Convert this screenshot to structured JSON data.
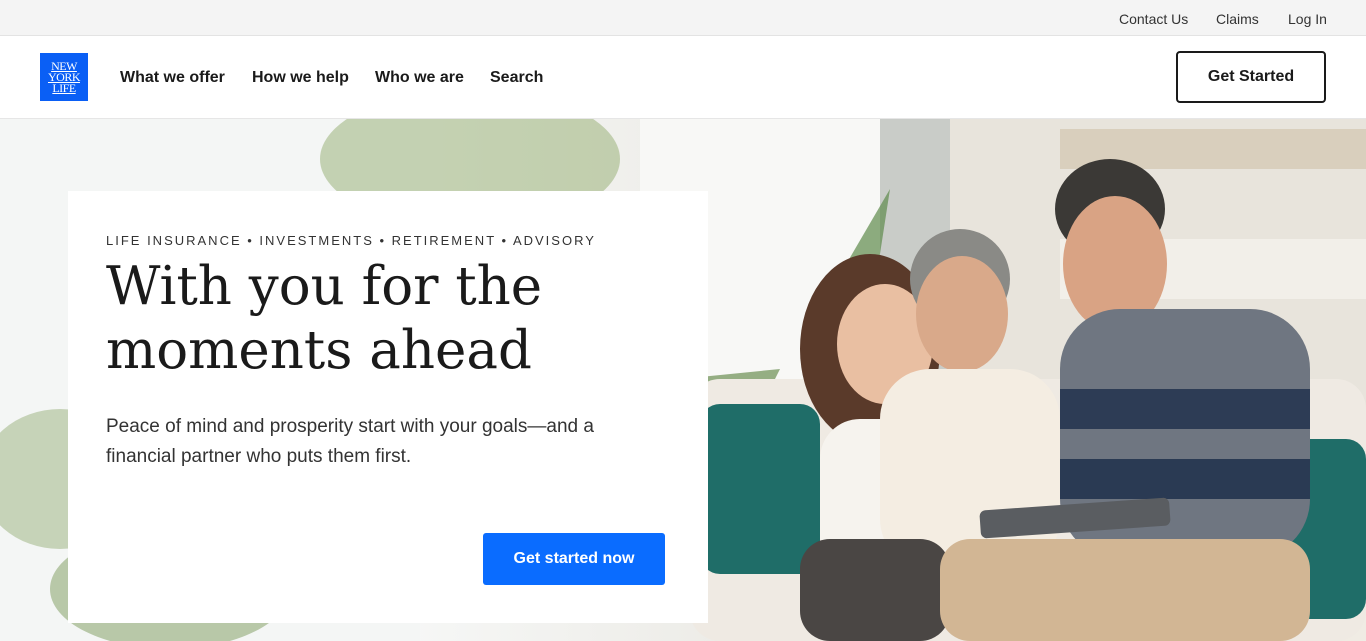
{
  "utility_nav": {
    "contact": "Contact Us",
    "claims": "Claims",
    "login": "Log In"
  },
  "logo": {
    "line1": "NEW",
    "line2": "YORK",
    "line3": "LIFE"
  },
  "main_nav": {
    "items": [
      "What we offer",
      "How we help",
      "Who we are",
      "Search"
    ],
    "cta": "Get Started"
  },
  "hero": {
    "eyebrow": "LIFE INSURANCE • INVESTMENTS • RETIREMENT • ADVISORY",
    "headline": "With you for the moments ahead",
    "subtext": "Peace of mind and prosperity start with your goals—and a financial partner who puts them first.",
    "cta": "Get started now"
  },
  "colors": {
    "brand_blue": "#0a5ff5",
    "cta_blue": "#0a6cff",
    "text_dark": "#1a1a1a"
  }
}
